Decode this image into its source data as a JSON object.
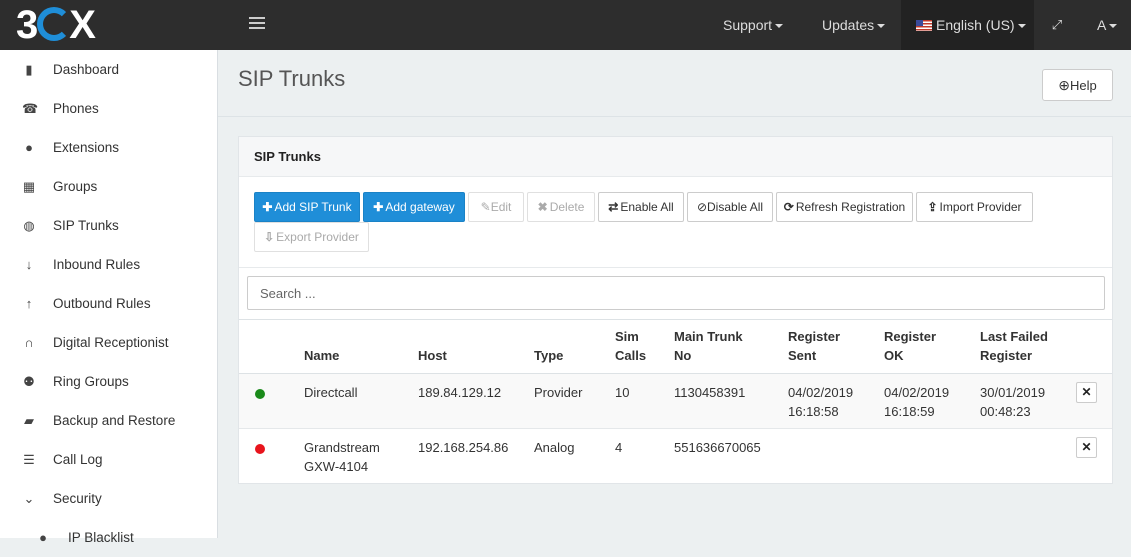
{
  "topbar": {
    "logo_text": "3CX",
    "nav": [
      {
        "label": "Support"
      },
      {
        "label": "Updates"
      },
      {
        "label": "English (US)"
      },
      {
        "label": "A"
      }
    ]
  },
  "sidebar": {
    "items": [
      {
        "label": "Dashboard",
        "icon": "bar-chart-icon",
        "glyph": "▮"
      },
      {
        "label": "Phones",
        "icon": "phone-icon",
        "glyph": "☎"
      },
      {
        "label": "Extensions",
        "icon": "user-icon",
        "glyph": "●"
      },
      {
        "label": "Groups",
        "icon": "grid-icon",
        "glyph": "▦"
      },
      {
        "label": "SIP Trunks",
        "icon": "globe-icon",
        "glyph": "◍"
      },
      {
        "label": "Inbound Rules",
        "icon": "arrow-down-icon",
        "glyph": "↓"
      },
      {
        "label": "Outbound Rules",
        "icon": "arrow-up-icon",
        "glyph": "↑"
      },
      {
        "label": "Digital Receptionist",
        "icon": "headset-icon",
        "glyph": "∩"
      },
      {
        "label": "Ring Groups",
        "icon": "users-icon",
        "glyph": "⚉"
      },
      {
        "label": "Backup and Restore",
        "icon": "folder-open-icon",
        "glyph": "▰"
      },
      {
        "label": "Call Log",
        "icon": "list-icon",
        "glyph": "☰"
      },
      {
        "label": "Security",
        "icon": "chevron-down-icon",
        "glyph": "⌄"
      },
      {
        "label": "IP Blacklist",
        "icon": "ban-icon",
        "glyph": "●"
      }
    ]
  },
  "page": {
    "title": "SIP Trunks",
    "help_label": "Help"
  },
  "panel": {
    "title": "SIP Trunks",
    "buttons": {
      "add_sip_trunk": "Add SIP Trunk",
      "add_gateway": "Add gateway",
      "edit": "Edit",
      "delete": "Delete",
      "enable_all": "Enable All",
      "disable_all": "Disable All",
      "refresh_registration": "Refresh Registration",
      "import_provider": "Import Provider",
      "export_provider": "Export Provider"
    },
    "search_placeholder": "Search ..."
  },
  "table": {
    "headers": {
      "name": "Name",
      "host": "Host",
      "type": "Type",
      "sim_calls_1": "Sim",
      "sim_calls_2": "Calls",
      "main_trunk_1": "Main Trunk",
      "main_trunk_2": "No",
      "reg_sent_1": "Register",
      "reg_sent_2": "Sent",
      "reg_ok_1": "Register",
      "reg_ok_2": "OK",
      "last_failed_1": "Last Failed",
      "last_failed_2": "Register"
    },
    "rows": [
      {
        "status_color": "#1a8a1a",
        "name_1": "Directcall",
        "name_2": "",
        "host": "189.84.129.12",
        "type": "Provider",
        "sim_calls": "10",
        "main_trunk": "1130458391",
        "reg_sent_1": "04/02/2019",
        "reg_sent_2": "16:18:58",
        "reg_ok_1": "04/02/2019",
        "reg_ok_2": "16:18:59",
        "last_failed_1": "30/01/2019",
        "last_failed_2": "00:48:23"
      },
      {
        "status_color": "#e8141c",
        "name_1": "Grandstream",
        "name_2": "GXW-4104",
        "host": "192.168.254.86",
        "type": "Analog",
        "sim_calls": "4",
        "main_trunk": "551636670065",
        "reg_sent_1": "",
        "reg_sent_2": "",
        "reg_ok_1": "",
        "reg_ok_2": "",
        "last_failed_1": "",
        "last_failed_2": ""
      }
    ]
  }
}
